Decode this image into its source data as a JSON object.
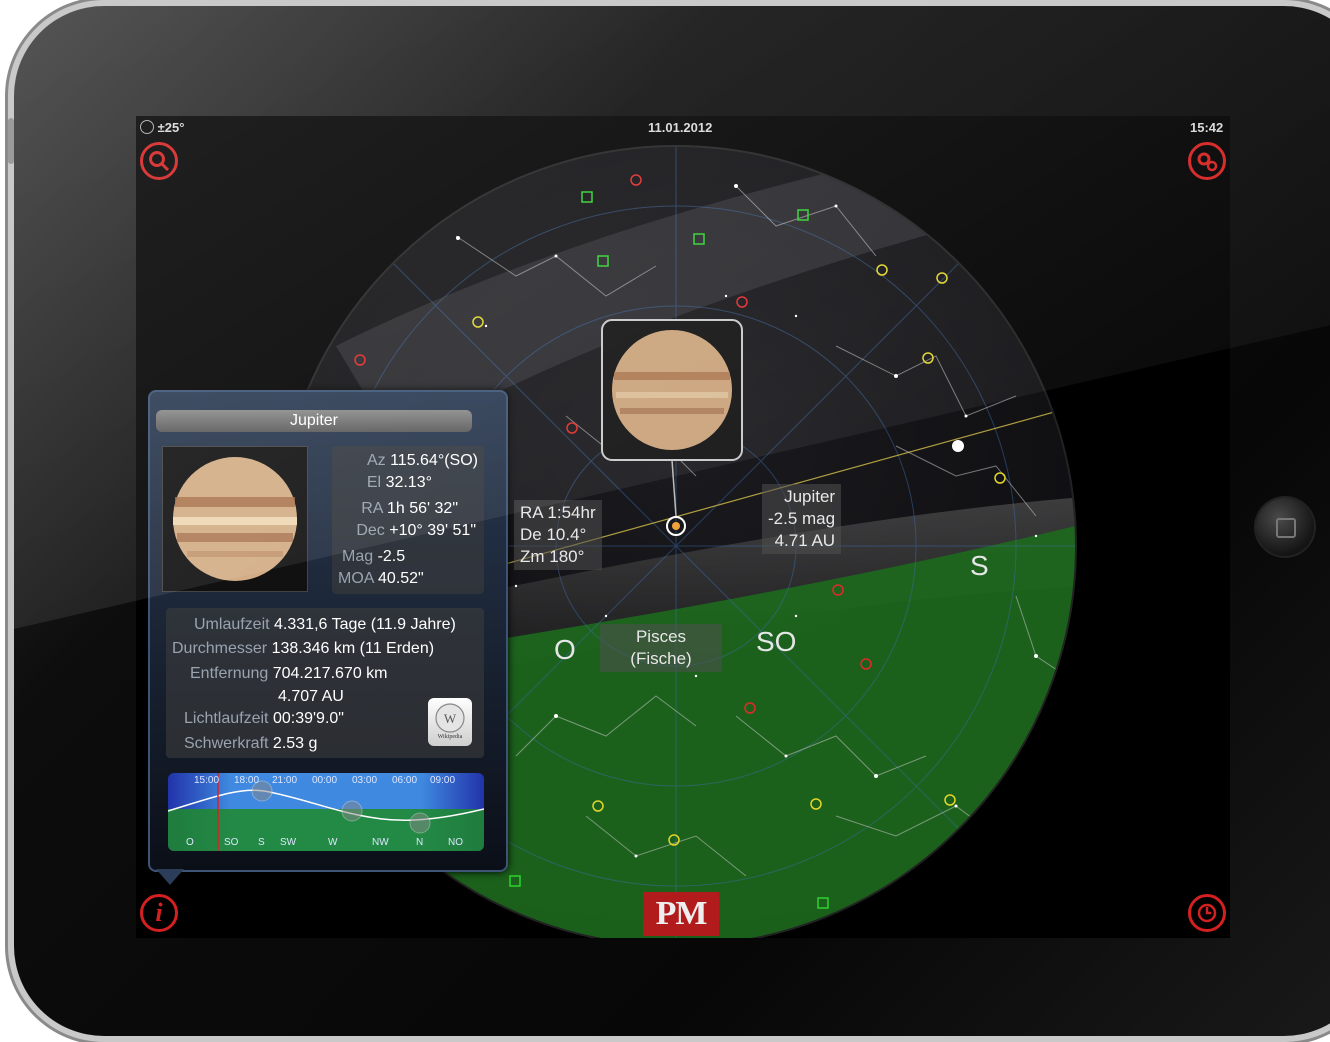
{
  "status_bar": {
    "fov": "±25°",
    "date": "11.01.2012",
    "time": "15:42"
  },
  "buttons": {
    "search_icon": "search-icon",
    "settings_icon": "gears-icon",
    "info_icon": "info-icon",
    "clock_icon": "clock-icon"
  },
  "sky": {
    "cursor_label": {
      "ra": "RA 1:54hr",
      "dec": "De 10.4°",
      "zm": "Zm 180°"
    },
    "object_label": {
      "name": "Jupiter",
      "mag": "-2.5 mag",
      "dist": "4.71 AU"
    },
    "constellation": {
      "name": "Pisces",
      "name_de": "(Fische)"
    },
    "compass": [
      "O",
      "SO",
      "S"
    ]
  },
  "panel": {
    "title": "Jupiter",
    "position": [
      {
        "key": "Az",
        "value": "115.64°(SO)"
      },
      {
        "key": "El",
        "value": "32.13°"
      },
      {
        "key": "RA",
        "value": "1h 56' 32\""
      },
      {
        "key": "Dec",
        "value": "+10° 39' 51\""
      },
      {
        "key": "Mag",
        "value": "-2.5"
      },
      {
        "key": "MOA",
        "value": "40.52\""
      }
    ],
    "facts": [
      {
        "key": "Umlaufzeit",
        "value": "4.331,6 Tage (11.9 Jahre)"
      },
      {
        "key": "Durchmesser",
        "value": "138.346 km (11 Erden)"
      },
      {
        "key": "Entfernung",
        "value": "704.217.670 km"
      },
      {
        "key": "",
        "value": "4.707 AU"
      },
      {
        "key": "Lichtlaufzeit",
        "value": "00:39'9.0\""
      },
      {
        "key": "Schwerkraft",
        "value": "2.53 g"
      }
    ],
    "wiki_label": "Wikipedia",
    "timeline": {
      "times": [
        "15:00",
        "18:00",
        "21:00",
        "00:00",
        "03:00",
        "06:00",
        "09:00"
      ],
      "directions": [
        "O",
        "SO",
        "S",
        "SW",
        "W",
        "NW",
        "N",
        "NO"
      ]
    }
  },
  "branding": {
    "logo": "PM"
  }
}
